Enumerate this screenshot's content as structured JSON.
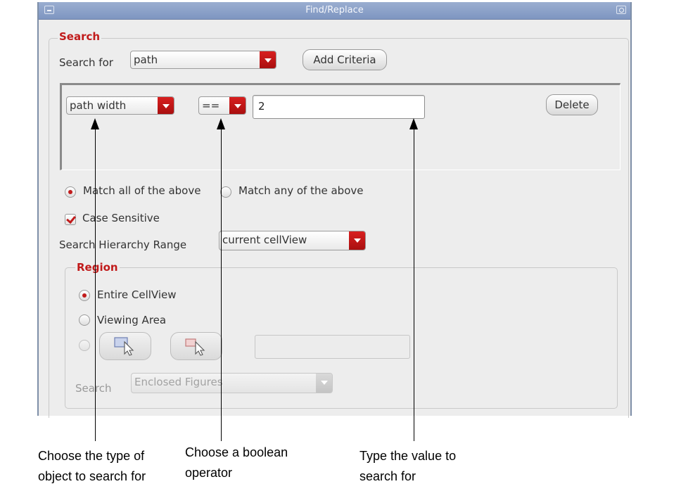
{
  "window": {
    "title": "Find/Replace"
  },
  "search": {
    "group_title": "Search",
    "search_for_label": "Search for",
    "search_for_value": "path",
    "add_criteria_label": "Add Criteria",
    "criteria": {
      "property_value": "path width",
      "operator_value": "==",
      "value_text": "2",
      "delete_label": "Delete"
    },
    "match_all_label": "Match all of the above",
    "match_any_label": "Match any of the above",
    "match_mode": "all",
    "case_sensitive_label": "Case Sensitive",
    "case_sensitive": true,
    "hierarchy_label": "Search Hierarchy Range",
    "hierarchy_value": "current cellView"
  },
  "region": {
    "group_title": "Region",
    "entire_label": "Entire CellView",
    "viewing_label": "Viewing Area",
    "selected": "entire",
    "search_label": "Search",
    "search_value": "Enclosed Figures"
  },
  "annotations": [
    {
      "lines": [
        "Choose the type of",
        "object to search for"
      ]
    },
    {
      "lines": [
        "Choose a boolean",
        "operator"
      ]
    },
    {
      "lines": [
        "Type the value to",
        "search for"
      ]
    }
  ],
  "colors": {
    "accent_red": "#c11b1b",
    "title_bar": "#8ea3c8",
    "panel_bg": "#ededed"
  }
}
